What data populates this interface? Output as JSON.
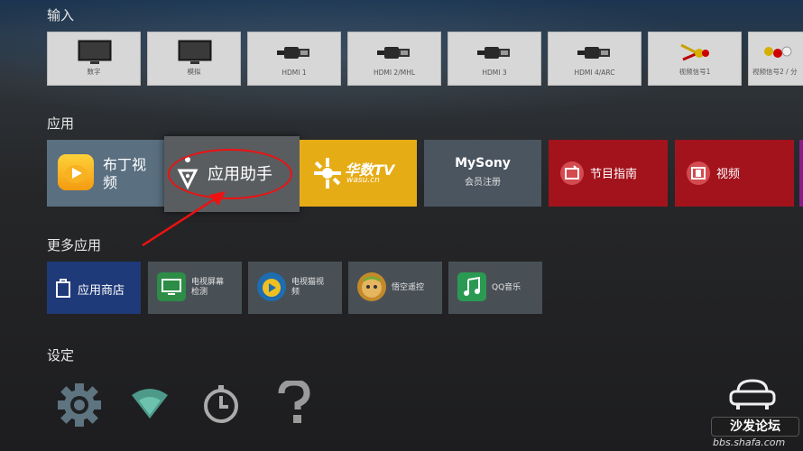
{
  "sections": {
    "inputs": "输入",
    "apps": "应用",
    "more_apps": "更多应用",
    "settings": "设定"
  },
  "inputs": [
    {
      "label": "数字",
      "icon": "tv-icon"
    },
    {
      "label": "模拟",
      "icon": "tv-icon"
    },
    {
      "label": "HDMI 1",
      "icon": "hdmi-icon"
    },
    {
      "label": "HDMI 2/MHL",
      "icon": "hdmi-icon"
    },
    {
      "label": "HDMI 3",
      "icon": "hdmi-icon"
    },
    {
      "label": "HDMI 4/ARC",
      "icon": "hdmi-icon"
    },
    {
      "label": "视频信号1",
      "icon": "rca-icon"
    },
    {
      "label": "视频信号2 / 分",
      "icon": "rca-icon"
    }
  ],
  "apps": [
    {
      "label": "布丁视频",
      "label_l1": "布丁视",
      "label_l2": "频",
      "color": "#5a6f80"
    },
    {
      "label": "应用助手",
      "color": "#5a5d60"
    },
    {
      "label": "华数TV",
      "sub": "wasu.cn",
      "color": "#e6ac16"
    },
    {
      "label": "MySony",
      "sub": "会员注册",
      "color": "#4a5560"
    },
    {
      "label": "节目指南",
      "color": "#a3131c"
    },
    {
      "label": "视频",
      "color": "#a3131c"
    }
  ],
  "more_apps": [
    {
      "label": "应用商店",
      "color": "#1f3a78"
    },
    {
      "label": "电视屏幕检测",
      "l1": "电视屏幕",
      "l2": "检测",
      "icon_color": "#2d8c46"
    },
    {
      "label": "电视猫视频",
      "l1": "电视猫视",
      "l2": "频",
      "icon_color": "#1e6db0"
    },
    {
      "label": "悟空遥控",
      "icon_color": "#c48a2a"
    },
    {
      "label": "QQ音乐",
      "icon_color": "#2a9a52"
    }
  ],
  "settings_icons": [
    "gear-icon",
    "wifi-icon",
    "timer-icon",
    "help-icon"
  ],
  "watermark": {
    "title": "沙发论坛",
    "url": "bbs.shafa.com"
  }
}
